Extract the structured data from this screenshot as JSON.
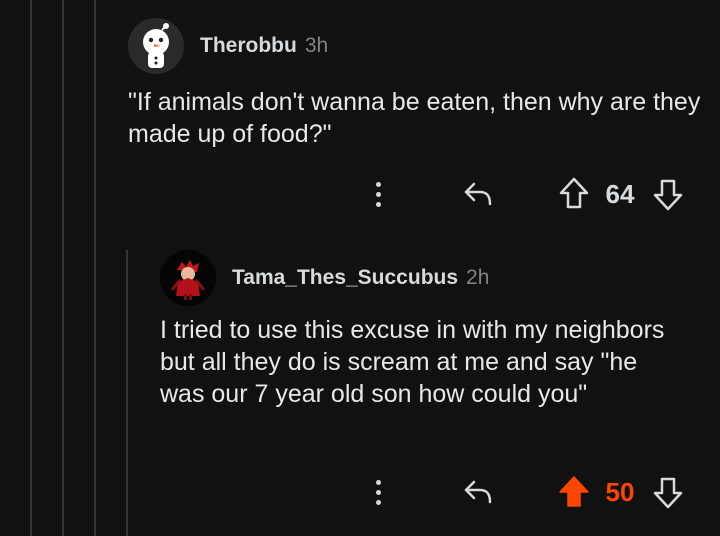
{
  "comments": [
    {
      "username": "Therobbu",
      "time": "3h",
      "text": "\"If animals don't wanna be eaten, then why are they made up of food?\"",
      "score": "64",
      "upvoted": false
    },
    {
      "username": "Tama_Thes_Succubus",
      "time": "2h",
      "text": "I tried to use this excuse in with my neighbors but all they do is scream at me and say \"he was our 7 year old son how could you\"",
      "score": "50",
      "upvoted": true
    }
  ],
  "colors": {
    "background": "#111111",
    "upvote": "#ff4500",
    "text": "#d7dadc",
    "muted": "#818384"
  }
}
